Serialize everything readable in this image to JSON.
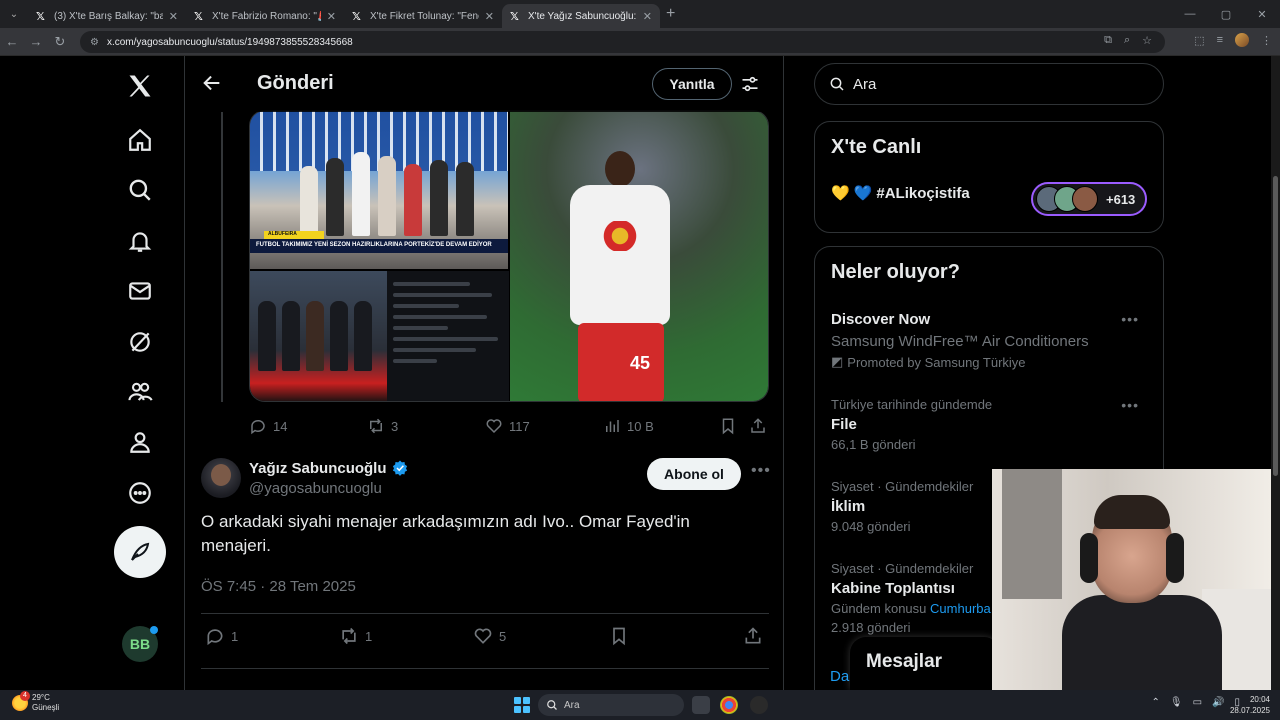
{
  "browser": {
    "tabs": [
      {
        "title": "(3) X'te Barış Balkay: \"başladık ..."
      },
      {
        "title": "X'te Fabrizio Romano: \"🚨🟡🔵..."
      },
      {
        "title": "X'te Fikret Tolunay: \"Fenerbahç..."
      },
      {
        "title": "X'te Yağız Sabuncuoğlu: \"@afr..."
      }
    ],
    "url": "x.com/yagosabuncuoglu/status/1949873855528345668"
  },
  "header": {
    "title": "Gönderi",
    "reply_label": "Yanıtla"
  },
  "media": {
    "caption": "FUTBOL TAKIMIMIZ YENİ SEZON HAZIRLIKLARINA PORTEKİZ'DE DEVAM EDİYOR",
    "tag": "ALBUFEIRA",
    "shirt_number": "45"
  },
  "tweet1_stats": {
    "replies": "14",
    "reposts": "3",
    "likes": "117",
    "views": "10 B"
  },
  "tweet2": {
    "name": "Yağız Sabuncuoğlu",
    "handle": "@yagosabuncuoglu",
    "subscribe_label": "Abone ol",
    "text": "O arkadaki siyahi menajer arkadaşımızın adı Ivo.. Omar Fayed'in menajeri.",
    "timestamp": "ÖS 7:45 · 28 Tem 2025",
    "replies": "1",
    "reposts": "1",
    "likes": "5"
  },
  "right": {
    "search_placeholder": "Ara",
    "live": {
      "title": "X'te Canlı",
      "hashtag": "#ALikoçistifa",
      "count": "+613"
    },
    "trends_title": "Neler oluyor?",
    "trends": [
      {
        "category": "",
        "name": "Discover Now",
        "sub": "Samsung WindFree™ Air Conditioners",
        "promo": "Promoted by Samsung Türkiye"
      },
      {
        "category": "Türkiye tarihinde gündemde",
        "name": "File",
        "sub": "66,1 B gönderi"
      },
      {
        "category": "Siyaset · Gündemdekiler",
        "name": "İklim",
        "sub": "9.048 gönderi"
      },
      {
        "category": "Siyaset · Gündemdekiler",
        "name": "Kabine Toplantısı",
        "sub_prefix": "Gündem konusu",
        "sub_link": "Cumhurba",
        "sub2": "2.918 gönderi"
      }
    ],
    "more_link": "Da"
  },
  "messages_label": "Mesajlar",
  "taskbar": {
    "weather_temp": "29°C",
    "weather_text": "Güneşli",
    "weather_badge": "4",
    "search_label": "Ara",
    "time": "20:04",
    "date": "28.07.2025"
  },
  "colors": {
    "accent": "#1d9bf0",
    "live_border": "#9b5cff",
    "background": "#000000"
  }
}
